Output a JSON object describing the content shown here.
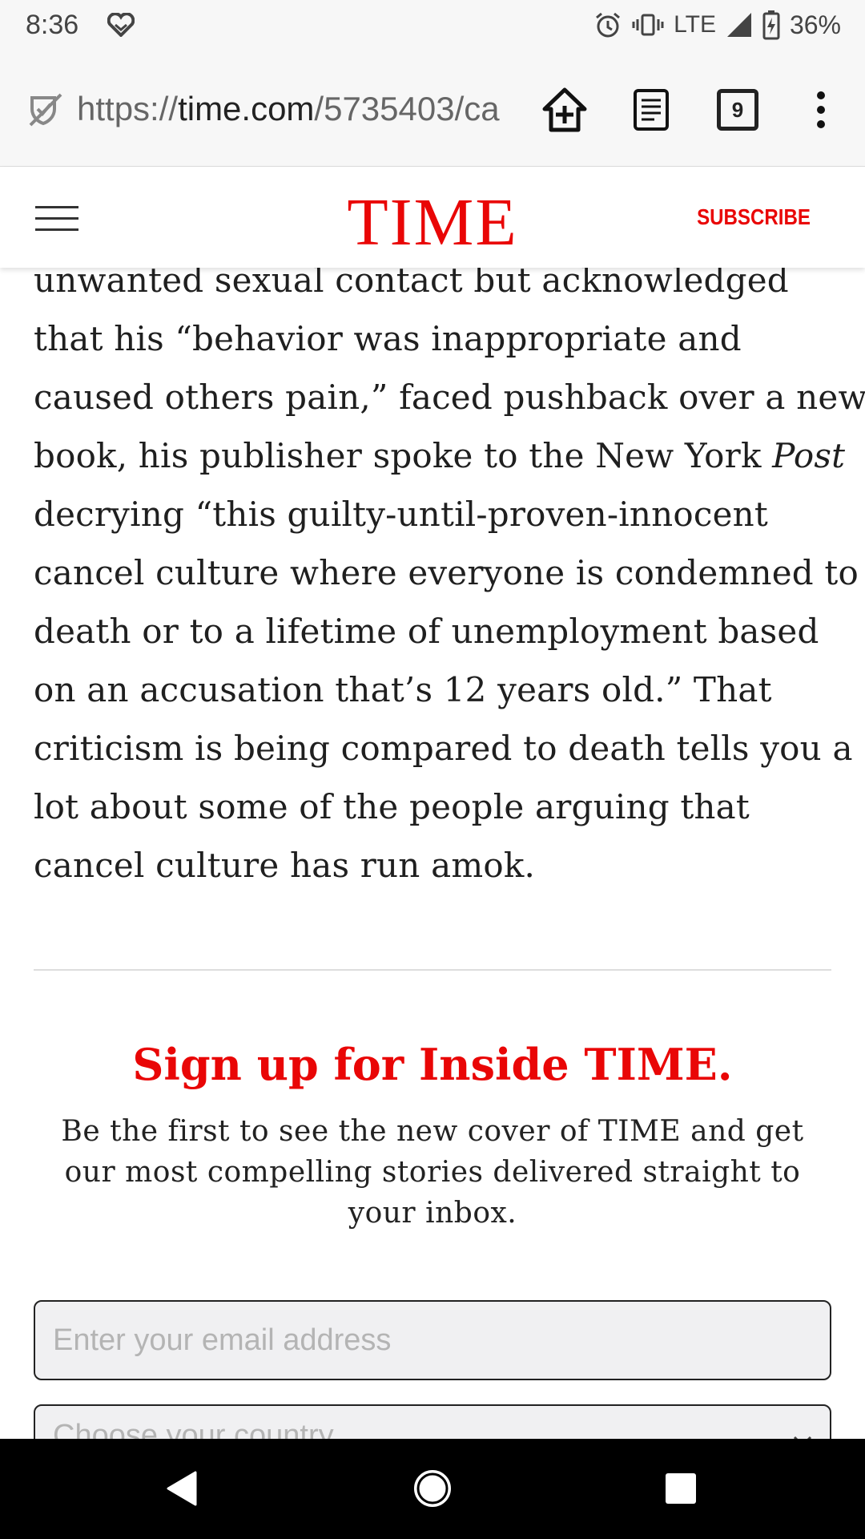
{
  "status_bar": {
    "time": "8:36",
    "network": "LTE",
    "battery": "36%"
  },
  "browser": {
    "url_scheme": "https://",
    "url_domain": "time.com",
    "url_path": "/5735403/ca",
    "tab_count": "9"
  },
  "site_header": {
    "logo": "TIME",
    "subscribe_label": "SUBSCRIBE",
    "brand_color": "#e90606"
  },
  "article": {
    "lines": [
      "unwanted sexual contact but acknowledged",
      "that his “behavior was inappropriate and",
      "caused others pain,” faced pushback over a new",
      "book, his publisher spoke to the New York ",
      "decrying “this guilty-until-proven-innocent",
      "cancel culture where everyone is condemned to",
      "death or to a lifetime of unemployment based",
      "on an accusation that’s 12 years old.” That",
      "criticism is being compared to death tells you a",
      "lot about some of the people arguing that",
      "cancel culture has run amok."
    ],
    "italic_word": "Post"
  },
  "signup": {
    "title": "Sign up for Inside TIME.",
    "description": "Be the first to see the new cover of TIME and get our most compelling stories delivered straight to your inbox.",
    "email_placeholder": "Enter your email address",
    "country_placeholder": "Choose your country"
  }
}
